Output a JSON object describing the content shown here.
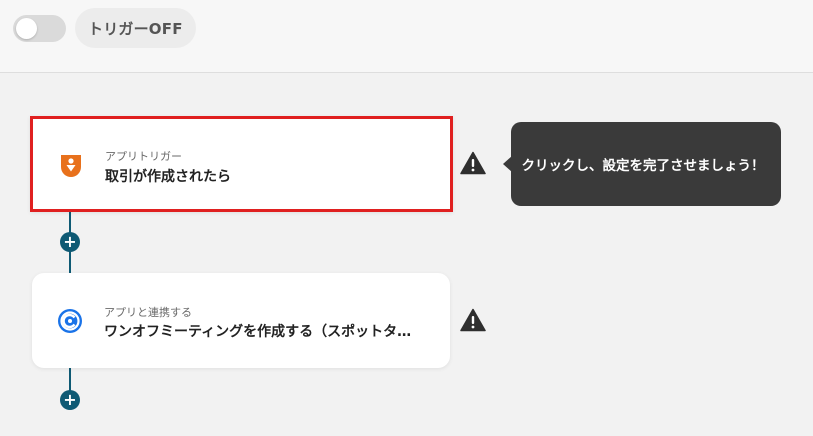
{
  "header": {
    "toggle_state": "off",
    "trigger_label": "トリガーOFF"
  },
  "flow": {
    "steps": [
      {
        "type_label": "アプリトリガー",
        "title": "取引が作成されたら",
        "icon": "trigger-app-icon",
        "icon_color": "#e8711c",
        "warning_icon": "warning-icon"
      },
      {
        "type_label": "アプリと連携する",
        "title": "ワンオフミーティングを作成する（スポットタ…",
        "icon": "meeting-app-icon",
        "icon_color": "#1a73e8",
        "warning_icon": "warning-icon"
      }
    ],
    "add_step_icon": "+"
  },
  "tooltip": {
    "text": "クリックし、設定を完了させましょう！"
  },
  "colors": {
    "connector": "#0f5a74",
    "selected_border": "#e02020",
    "tooltip_bg": "#3a3a3a"
  }
}
